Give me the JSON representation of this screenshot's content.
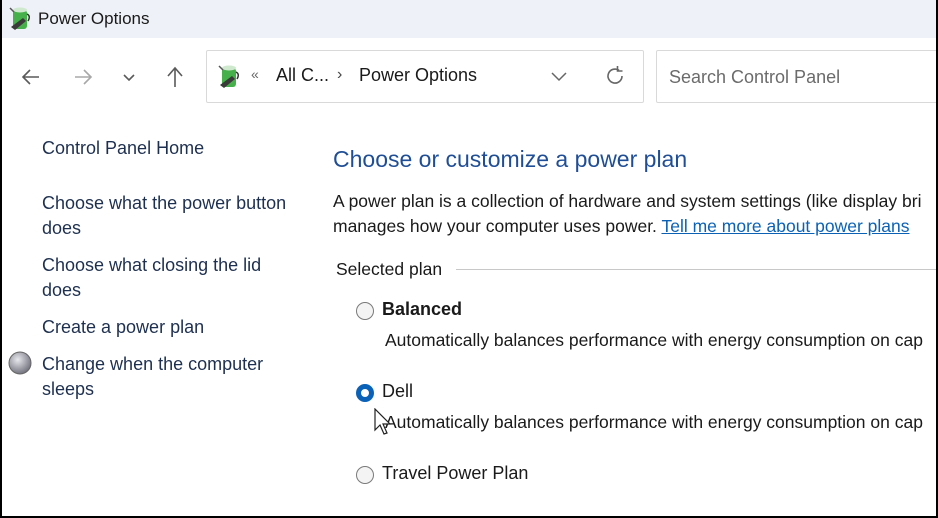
{
  "window": {
    "title": "Power Options",
    "icon": "power-options-battery-icon"
  },
  "navigation": {
    "back_icon": "arrow-left-icon",
    "forward_icon": "arrow-right-icon",
    "recent_icon": "chevron-down-icon",
    "up_icon": "arrow-up-icon"
  },
  "address_bar": {
    "overflow": "«",
    "breadcrumbs": [
      {
        "label": "All C..."
      },
      {
        "label": "Power Options"
      }
    ],
    "separator": "›",
    "dropdown_icon": "chevron-down-icon",
    "refresh_icon": "refresh-icon"
  },
  "search": {
    "placeholder": "Search Control Panel",
    "value": ""
  },
  "sidebar": {
    "home_link": "Control Panel Home",
    "links": [
      {
        "label": "Choose what the power button does"
      },
      {
        "label": "Choose what closing the lid does"
      },
      {
        "label": "Create a power plan"
      },
      {
        "label": "Change when the computer sleeps",
        "icon": "moon-sleep-icon"
      }
    ]
  },
  "main": {
    "heading": "Choose or customize a power plan",
    "description_line1": "A power plan is a collection of hardware and system settings (like display bri",
    "description_line2": "manages how your computer uses power. ",
    "learn_more_link": "Tell me more about power plans",
    "group_label": "Selected plan",
    "plans": [
      {
        "name": "Balanced",
        "selected": false,
        "bold": true,
        "description": "Automatically balances performance with energy consumption on cap"
      },
      {
        "name": "Dell",
        "selected": true,
        "bold": false,
        "description": "Automatically balances performance with energy consumption on cap"
      },
      {
        "name": "Travel Power Plan",
        "selected": false,
        "bold": false,
        "description": ""
      }
    ]
  },
  "colors": {
    "heading": "#1f4e96",
    "link": "#0b62b5",
    "sidebar_link": "#1e3050",
    "radio_selected": "#0a62b8",
    "titlebar": "#eef1f7"
  }
}
